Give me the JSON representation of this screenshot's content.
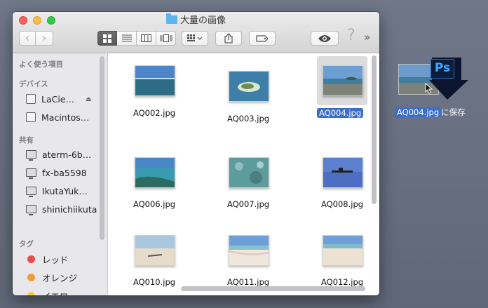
{
  "window": {
    "title": "大量の画像"
  },
  "toolbar": {
    "back_glyph": "‹",
    "forward_glyph": "›",
    "help_glyph": "?",
    "more_glyph": "»"
  },
  "sidebar": {
    "sections": [
      {
        "label": "よく使う項目"
      },
      {
        "label": "デバイス"
      },
      {
        "label": "共有"
      },
      {
        "label": "タグ"
      }
    ],
    "devices": [
      {
        "label": "LaCie…",
        "icon": "disk-icon"
      },
      {
        "label": "Macintos…",
        "icon": "disk-icon"
      }
    ],
    "shared": [
      {
        "label": "aterm-6b…",
        "icon": "monitor-icon"
      },
      {
        "label": "fx-ba5598",
        "icon": "monitor-icon"
      },
      {
        "label": "IkutaYuk…",
        "icon": "laptop-icon"
      },
      {
        "label": "shinichiikuta",
        "icon": "monitor-icon"
      }
    ],
    "tags": [
      {
        "label": "レッド",
        "color": "#f0474a"
      },
      {
        "label": "オレンジ",
        "color": "#f59b34"
      },
      {
        "label": "イエロー",
        "color": "#f5cd3a"
      }
    ]
  },
  "files": [
    {
      "name": "AQ002.jpg",
      "variant": "sea-horizon",
      "selected": false
    },
    {
      "name": "AQ003.jpg",
      "variant": "island-aerial",
      "selected": false
    },
    {
      "name": "AQ004.jpg",
      "variant": "rocky-shore",
      "selected": true
    },
    {
      "name": "AQ006.jpg",
      "variant": "reef-water",
      "selected": false
    },
    {
      "name": "AQ007.jpg",
      "variant": "underwater",
      "selected": false
    },
    {
      "name": "AQ008.jpg",
      "variant": "ship-sea",
      "selected": false
    },
    {
      "name": "AQ010.jpg",
      "variant": "beach-log",
      "selected": false
    },
    {
      "name": "AQ011.jpg",
      "variant": "white-beach",
      "selected": false
    },
    {
      "name": "AQ012.jpg",
      "variant": "sand-beach",
      "selected": false
    }
  ],
  "drag": {
    "file_name": "AQ004.jpg",
    "suffix": "に保存",
    "app_badge": "Ps"
  }
}
